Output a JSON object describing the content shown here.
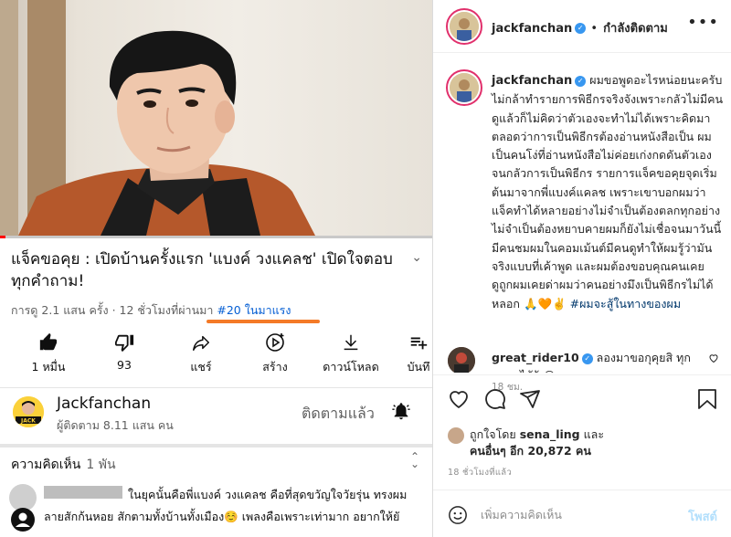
{
  "youtube": {
    "video": {
      "title": "แจ็คขอคุย : เปิดบ้านครั้งแรก 'แบงค์ วงแคลช' เปิดใจตอบทุกคำถาม!",
      "meta_views": "การดู 2.1 แสน ครั้ง · 12 ชั่วโมงที่ผ่านมา ",
      "trending": "#20 ในมาแรง"
    },
    "actions": [
      {
        "icon": "thumbs-up-icon",
        "label": "1 หมื่น"
      },
      {
        "icon": "thumbs-down-icon",
        "label": "93"
      },
      {
        "icon": "share-icon",
        "label": "แชร์"
      },
      {
        "icon": "create-clip-icon",
        "label": "สร้าง"
      },
      {
        "icon": "download-icon",
        "label": "ดาวน์โหลด"
      },
      {
        "icon": "save-icon",
        "label": "บันทึ"
      }
    ],
    "channel": {
      "name": "Jackfanchan",
      "subscribers": "ผู้ติดตาม 8.11 แสน คน",
      "subscribed_label": "ติดตามแล้ว",
      "avatar_text": "JACK"
    },
    "comments": {
      "header": "ความคิดเห็น",
      "count": "1 พัน",
      "top_line1": "ในยุคนั้นคือพี่แบงค์ วงแคลช คือที่สุดขวัญใจวัยรุ่น ทรงผม",
      "top_line2": "ลายสักก้นหอย สักตามทั้งบ้านทั้งเมือง☺️ เพลงคือเพราะเท่ามาก อยากให้ยั"
    }
  },
  "instagram": {
    "header": {
      "username": "jackfanchan",
      "follow_label": "กำลังติดตาม"
    },
    "caption": {
      "username": "jackfanchan",
      "text": " ผมขอพูดอะไรหน่อยนะครับ ไม่กล้าทำรายการพิธีกรจริงจังเพราะกลัวไม่มีคนดูแล้วก็ไม่คิดว่าตัวเองจะทำไม่ได้เพราะคิดมาตลอดว่าการเป็นพิธีกรต้องอ่านหนังสือเป็น ผมเป็นคนโง่ที่อ่านหนังสือไม่ค่อยเก่งกดดันตัวเองจนกลัวการเป็นพิธีกร รายการแจ็คขอคุยจุดเริ่มต้นมาจากพี่แบงค์แคลช เพราะเขาบอกผมว่าแจ็คทำได้หลายอย่างไม่จำเป็นต้องตลกทุกอย่างไม่จำเป็นต้องหยาบคายผมก็ยังไม่เชื่อจนมาวันนี้มีคนชมผมในคอมเม้นต์มีคนดูทำให้ผมรู้ว่ามันจริงแบบที่เค้าพูด และผมต้องขอบคุณคนเคยดูถูกผมเคยด่าผมว่าคนอย่างมึงเป็นพิธีกรไม่ได้หลอก 🙏🧡✌️ ",
      "hashtag": "#ผมจะสู้ในทางของผม",
      "time": "18 ชม."
    },
    "comment": {
      "username": "great_rider10",
      "text": " ลองมาขอกุคุยสิ ทุก คนจะได้รู้ 😂"
    },
    "likes": {
      "liked_by_prefix": "ถูกใจโดย ",
      "liked_by_user": "sena_ling",
      "liked_by_suffix": " และ",
      "others": "คนอื่นๆ อีก 20,872 คน"
    },
    "date": "18 ชั่วโมงที่แล้ว",
    "add_comment": {
      "placeholder": "เพิ่มความคิดเห็น",
      "post_label": "โพสต์"
    },
    "colors": {
      "verified": "#3897f0",
      "hashtag": "#00376b",
      "post_disabled": "#b2dffc"
    }
  },
  "colors": {
    "trend_link": "#065fd4",
    "highlight_underline": "#f47a27",
    "progress": "#ff0000"
  }
}
